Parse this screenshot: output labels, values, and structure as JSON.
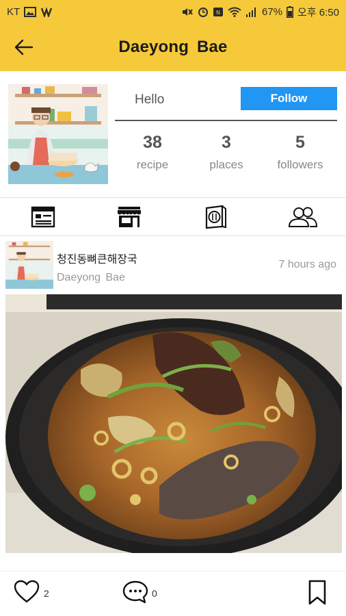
{
  "colors": {
    "header_bg": "#f5c93a",
    "accent": "#2196f3"
  },
  "status_bar": {
    "carrier": "KT",
    "battery": "67%",
    "time": "오후 6:50",
    "icons": [
      "image-icon",
      "vibration-icon",
      "mute-icon",
      "alarm-icon",
      "nfc-icon",
      "wifi-icon",
      "signal-icon",
      "battery-icon"
    ]
  },
  "header": {
    "title": "Daeyong  Bae",
    "back_icon": "arrow-left-icon"
  },
  "profile": {
    "greeting": "Hello",
    "follow_label": "Follow",
    "stats": [
      {
        "value": "38",
        "label": "recipe"
      },
      {
        "value": "3",
        "label": "places"
      },
      {
        "value": "5",
        "label": "followers"
      }
    ]
  },
  "tabs": [
    {
      "name": "recipe-list-icon"
    },
    {
      "name": "store-icon"
    },
    {
      "name": "dining-icon"
    },
    {
      "name": "people-icon"
    }
  ],
  "post": {
    "title": "청진동뼈큰해장국",
    "author": "Daeyong  Bae",
    "time": "7 hours ago",
    "like_count": "2",
    "comment_count": "0"
  }
}
